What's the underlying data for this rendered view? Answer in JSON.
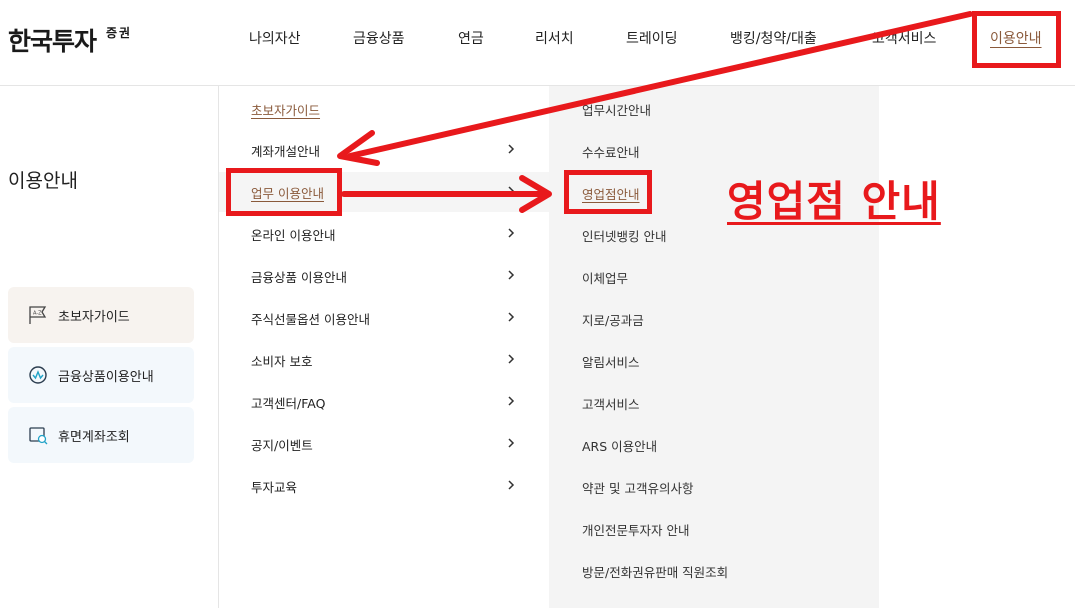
{
  "header": {
    "logo_main": "한국투자",
    "logo_sub": "증권",
    "nav": [
      "나의자산",
      "금융상품",
      "연금",
      "리서치",
      "트레이딩",
      "뱅킹/청약/대출",
      "고객서비스",
      "이용안내"
    ]
  },
  "left": {
    "title": "이용안내",
    "quick_links": [
      "초보자가이드",
      "금융상품이용안내",
      "휴면계좌조회"
    ],
    "quick_colors": [
      "#f7f3ef",
      "#f3f8fc",
      "#f3f8fc"
    ]
  },
  "menu": {
    "top_item": "초보자가이드",
    "items": [
      "계좌개설안내",
      "업무 이용안내",
      "온라인 이용안내",
      "금융상품 이용안내",
      "주식선물옵션 이용안내",
      "소비자 보호",
      "고객센터/FAQ",
      "공지/이벤트",
      "투자교육"
    ]
  },
  "submenu": {
    "items": [
      "업무시간안내",
      "수수료안내",
      "영업점안내",
      "인터넷뱅킹 안내",
      "이체업무",
      "지로/공과금",
      "알림서비스",
      "고객서비스",
      "ARS 이용안내",
      "약관 및 고객유의사항",
      "개인전문투자자 안내",
      "방문/전화권유판매 직원조회"
    ]
  },
  "annotation": {
    "text": "영업점 안내",
    "color": "#e8191c"
  },
  "colors": {
    "accent": "#8a5a3b",
    "submenu_bg": "#f4f4f4"
  }
}
